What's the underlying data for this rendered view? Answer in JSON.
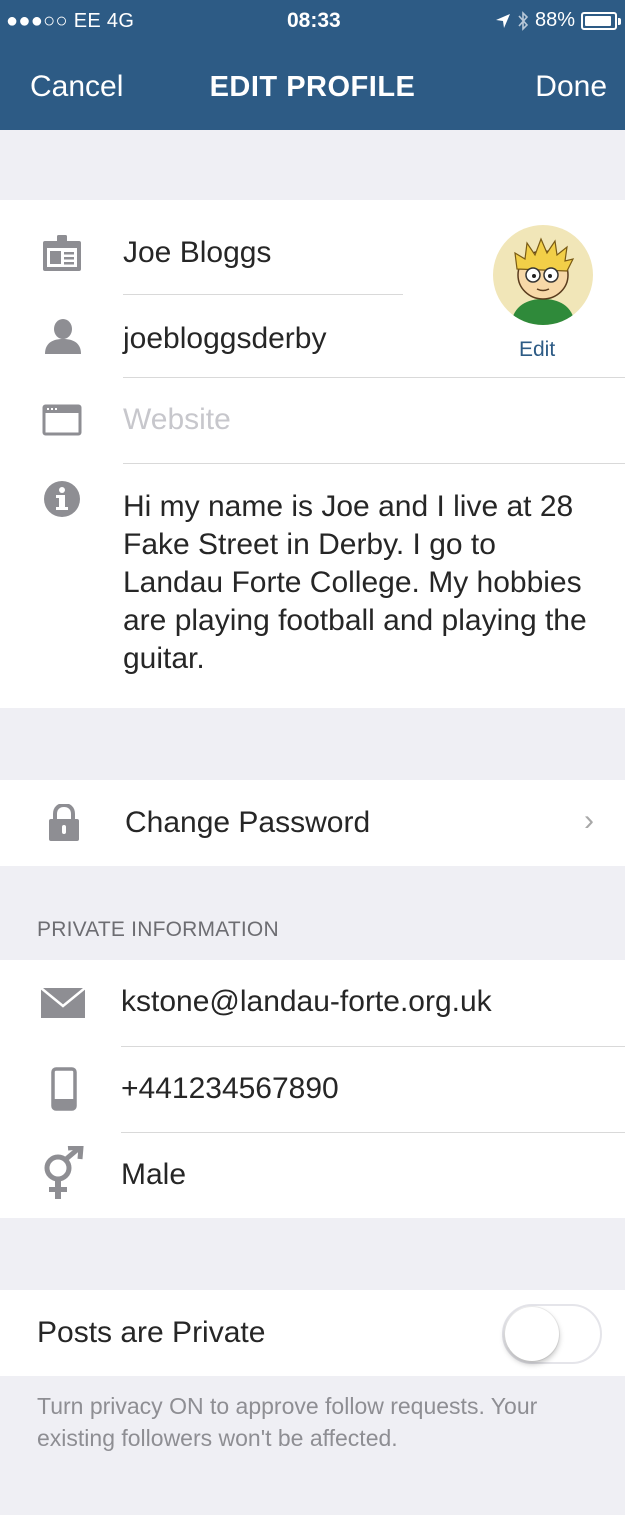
{
  "status_bar": {
    "carrier": "●●●○○ EE  4G",
    "time": "08:33",
    "battery": "88%"
  },
  "nav": {
    "cancel": "Cancel",
    "title": "EDIT PROFILE",
    "done": "Done"
  },
  "profile": {
    "name": "Joe Bloggs",
    "username": "joebloggsderby",
    "website_placeholder": "Website",
    "bio": "Hi my name is Joe and I live at 28 Fake Street in Derby. I go to Landau Forte College. My hobbies are playing football and playing the guitar.",
    "avatar_edit": "Edit"
  },
  "account": {
    "change_password": "Change Password",
    "chevron": "›"
  },
  "private_info": {
    "header": "PRIVATE INFORMATION",
    "email": "kstone@landau-forte.org.uk",
    "phone": "+441234567890",
    "gender": "Male"
  },
  "privacy": {
    "label": "Posts are Private",
    "toggle_on": false,
    "note": "Turn privacy ON to approve follow requests. Your existing followers won't be affected."
  },
  "colors": {
    "nav_bg": "#2d5b85",
    "icon_gray": "#8e8e93",
    "link_blue": "#2d5b85"
  },
  "icons": {
    "name": "id-card-icon",
    "username": "person-icon",
    "website": "browser-window-icon",
    "bio": "info-icon",
    "password": "lock-icon",
    "email": "envelope-icon",
    "phone": "phone-icon",
    "gender": "gender-icon"
  }
}
